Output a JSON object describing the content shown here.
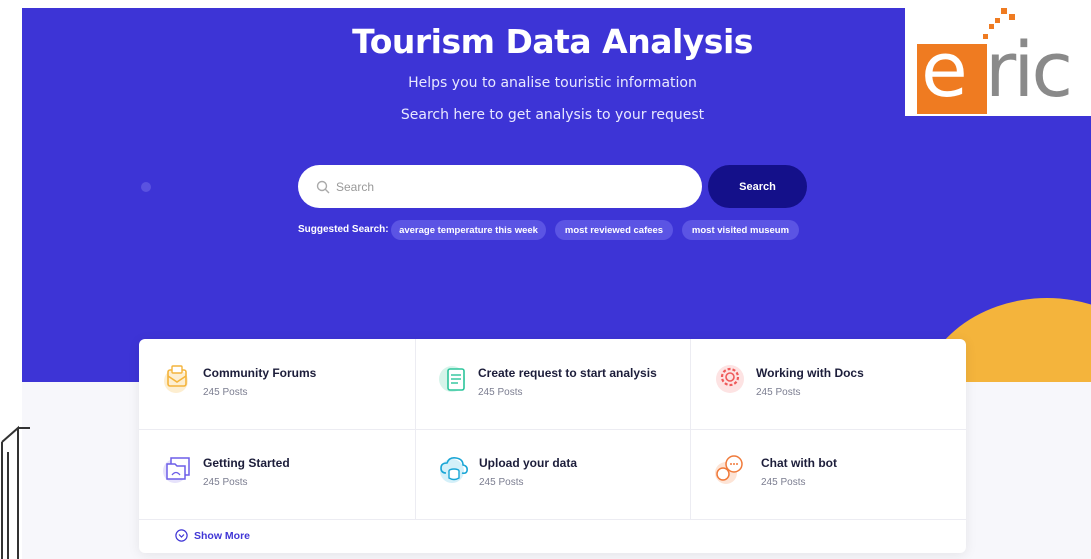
{
  "hero": {
    "title": "Tourism Data Analysis",
    "subtitle": "Helps you to analise touristic information",
    "subtitle2": "Search here to get analysis to your request"
  },
  "search": {
    "placeholder": "Search",
    "button_label": "Search",
    "icon": "search-icon"
  },
  "suggested": {
    "label": "Suggested Search:",
    "chips": [
      "average temperature this week",
      "most reviewed cafees",
      "most visited museum"
    ]
  },
  "logo": {
    "text_e": "e",
    "text_rest": "ric",
    "colors": {
      "orange": "#ef7b21",
      "gray": "#8a8a8a"
    }
  },
  "categories": [
    {
      "name": "Community Forums",
      "count": "245 Posts",
      "icon": "envelope-icon",
      "color": "#f4b43c"
    },
    {
      "name": "Create request to start analysis",
      "count": "245 Posts",
      "icon": "document-icon",
      "color": "#2bc59b"
    },
    {
      "name": "Working with Docs",
      "count": "245 Posts",
      "icon": "gear-icon",
      "color": "#ef5a5a"
    },
    {
      "name": "Getting Started",
      "count": "245 Posts",
      "icon": "folder-icon",
      "color": "#6d5ee8"
    },
    {
      "name": "Upload your data",
      "count": "245 Posts",
      "icon": "cloud-database-icon",
      "color": "#1aa6d6"
    },
    {
      "name": "Chat with bot",
      "count": "245 Posts",
      "icon": "chat-bubbles-icon",
      "color": "#f07a3a"
    }
  ],
  "show_more": "Show More",
  "colors": {
    "hero_bg": "#3d34d6",
    "search_button": "#14108a",
    "accent": "#4036d6",
    "blob": "#f4b43c"
  }
}
